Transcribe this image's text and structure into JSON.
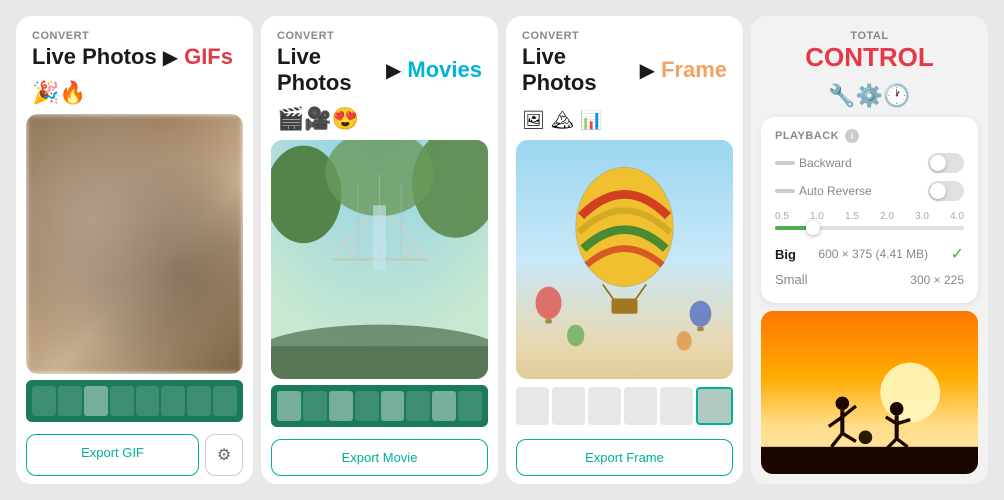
{
  "panels": [
    {
      "id": "gif-panel",
      "convert_label": "CONVERT",
      "title_live": "Live Photos",
      "arrow": "▶",
      "title_target": "GIFs",
      "title_target_class": "title-target-gif",
      "icons": "🎉🔥",
      "export_button": "Export GIF",
      "has_settings": true,
      "filmstrip": true
    },
    {
      "id": "movie-panel",
      "convert_label": "CONVERT",
      "title_live": "Live Photos",
      "arrow": "▶",
      "title_target": "Movies",
      "title_target_class": "title-target-movie",
      "icons": "🎬🎥😍",
      "export_button": "Export Movie",
      "has_settings": false,
      "filmstrip": true
    },
    {
      "id": "frame-panel",
      "convert_label": "CONVERT",
      "title_live": "Live Photos",
      "arrow": "▶",
      "title_target": "Frame",
      "title_target_class": "title-target-frame",
      "icons_text": "frame-icons",
      "export_button": "Export Frame",
      "has_settings": false,
      "filmstrip": false,
      "frame_strip": true
    },
    {
      "id": "control-panel",
      "total_label": "TOTAL",
      "total_title": "CONTROL",
      "icons": "🔧⚙️🕐",
      "playback_label": "PLAYBACK",
      "backward_label": "Backward",
      "auto_reverse_label": "Auto Reverse",
      "slider_labels": [
        "0.5",
        "1.0",
        "1.5",
        "2.0",
        "3.0",
        "4.0"
      ],
      "size_big_label": "Big",
      "size_big_dims": "600 × 375 (4.41 MB)",
      "size_small_label": "Small",
      "size_small_dims": "300 × 225"
    }
  ]
}
